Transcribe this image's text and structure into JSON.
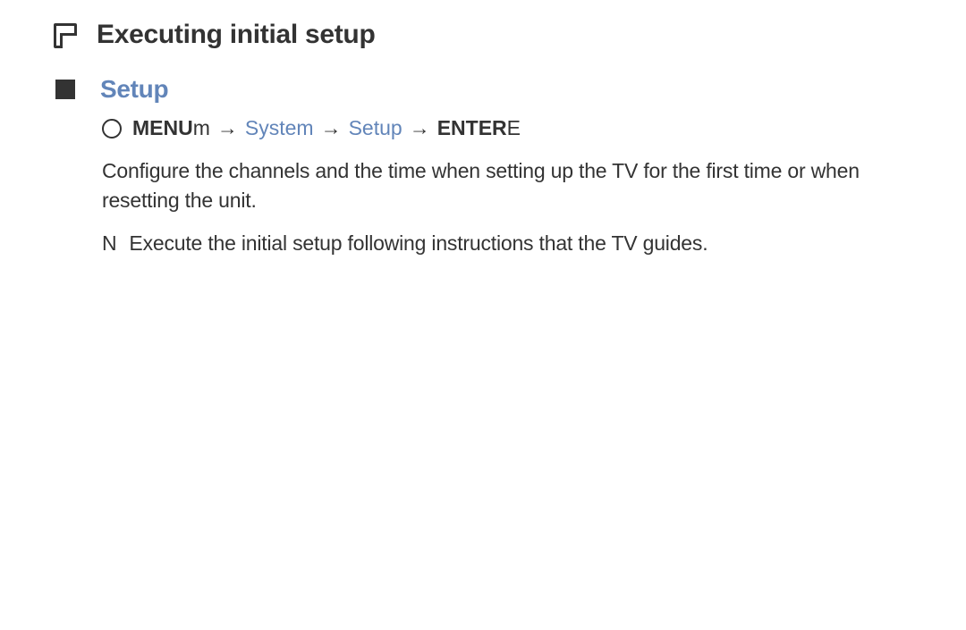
{
  "page": {
    "title": "Executing initial setup"
  },
  "section": {
    "title": "Setup"
  },
  "path": {
    "menu_bold": "MENU",
    "menu_suffix": "m",
    "arrow1": "→",
    "system": "System",
    "arrow2": "→",
    "setup": "Setup",
    "arrow3": "→",
    "enter_bold": "ENTER",
    "enter_suffix": "E"
  },
  "body": {
    "paragraph": "Configure the channels and the time when setting up the TV for the first time or when resetting the unit."
  },
  "note": {
    "marker": "N",
    "text": "Execute the initial setup following instructions that the TV guides."
  }
}
